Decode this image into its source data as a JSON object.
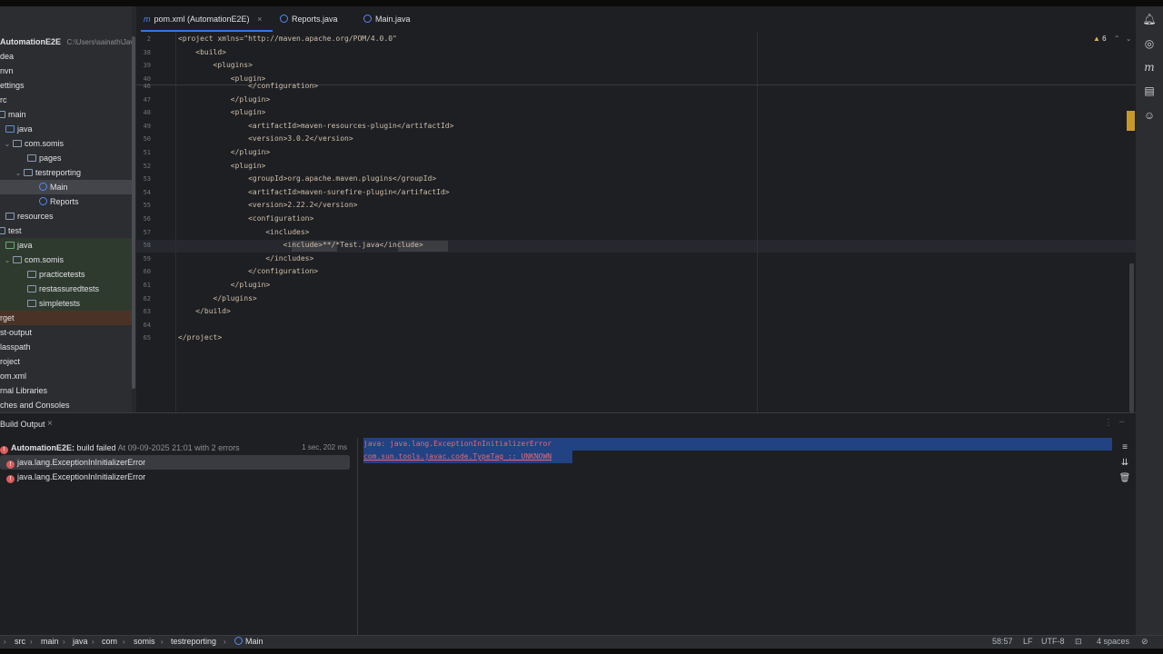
{
  "project": {
    "root_name": "AutomationE2E",
    "root_path": "C:\\Users\\sainath\\JavaF",
    "items": [
      {
        "label": "dea"
      },
      {
        "label": "nvn"
      },
      {
        "label": "ettings"
      },
      {
        "label": "rc"
      },
      {
        "label": "main"
      },
      {
        "label": "java"
      },
      {
        "label": "com.somis"
      },
      {
        "label": "pages"
      },
      {
        "label": "testreporting"
      },
      {
        "label": "Main"
      },
      {
        "label": "Reports"
      },
      {
        "label": "resources"
      },
      {
        "label": "test"
      },
      {
        "label": "java"
      },
      {
        "label": "com.somis"
      },
      {
        "label": "practicetests"
      },
      {
        "label": "restassuredtests"
      },
      {
        "label": "simpletests"
      },
      {
        "label": "rget"
      },
      {
        "label": "st-output"
      },
      {
        "label": "lasspath"
      },
      {
        "label": "roject"
      },
      {
        "label": "om.xml"
      },
      {
        "label": "rnal Libraries"
      },
      {
        "label": "ches and Consoles"
      }
    ]
  },
  "tabs": [
    {
      "label": "pom.xml (AutomationE2E)",
      "icon": "m"
    },
    {
      "label": "Reports.java",
      "icon": "class-icon"
    },
    {
      "label": "Main.java",
      "icon": "class-icon"
    }
  ],
  "editor": {
    "warnings_count": "6",
    "sticky_lines": [
      {
        "num": "2",
        "text": "<project xmlns=\"http://maven.apache.org/POM/4.0.0\""
      },
      {
        "num": "38",
        "text": "    <build>"
      },
      {
        "num": "39",
        "text": "        <plugins>"
      },
      {
        "num": "40",
        "text": "            <plugin>"
      }
    ],
    "lines": [
      {
        "num": "46",
        "text": "                </configuration>"
      },
      {
        "num": "47",
        "text": "            </plugin>"
      },
      {
        "num": "48",
        "text": "            <plugin>"
      },
      {
        "num": "49",
        "text": "                <artifactId>maven-resources-plugin</artifactId>"
      },
      {
        "num": "50",
        "text": "                <version>3.0.2</version>"
      },
      {
        "num": "51",
        "text": "            </plugin>"
      },
      {
        "num": "52",
        "text": "            <plugin>"
      },
      {
        "num": "53",
        "text": "                <groupId>org.apache.maven.plugins</groupId>"
      },
      {
        "num": "54",
        "text": "                <artifactId>maven-surefire-plugin</artifactId>"
      },
      {
        "num": "55",
        "text": "                <version>2.22.2</version>"
      },
      {
        "num": "56",
        "text": "                <configuration>"
      },
      {
        "num": "57",
        "text": "                    <includes>"
      },
      {
        "num": "58",
        "text": "                        <include>**/*Test.java</include>"
      },
      {
        "num": "59",
        "text": "                    </includes>"
      },
      {
        "num": "60",
        "text": "                </configuration>"
      },
      {
        "num": "61",
        "text": "            </plugin>"
      },
      {
        "num": "62",
        "text": "        </plugins>"
      },
      {
        "num": "63",
        "text": "    </build>"
      },
      {
        "num": "64",
        "text": ""
      },
      {
        "num": "65",
        "text": "</project>"
      }
    ]
  },
  "build": {
    "tab_label": "Build Output",
    "summary_name": "AutomationE2E:",
    "summary_text": "build failed",
    "summary_time": "At 09-09-2025 21:01 with 2 errors",
    "duration": "1 sec, 202 ms",
    "errors": [
      {
        "label": "java.lang.ExceptionInInitializerError"
      },
      {
        "label": "java.lang.ExceptionInInitializerError"
      }
    ],
    "output_lines": [
      "java: java.lang.ExceptionInInitializerError",
      "com.sun.tools.javac.code.TypeTag :: UNKNOWN"
    ]
  },
  "breadcrumb": [
    "src",
    "main",
    "java",
    "com",
    "somis",
    "testreporting",
    "Main"
  ],
  "status": {
    "position": "58:57",
    "line_sep": "LF",
    "encoding": "UTF-8",
    "indent": "4 spaces"
  }
}
